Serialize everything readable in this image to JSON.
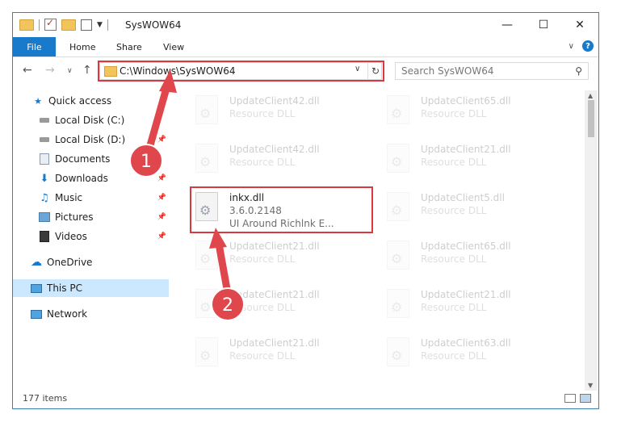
{
  "window": {
    "title": "SysWOW64",
    "minimize_glyph": "—",
    "maximize_glyph": "☐",
    "close_glyph": "✕"
  },
  "ribbon": {
    "tabs": [
      "File",
      "Home",
      "Share",
      "View"
    ]
  },
  "address": {
    "path": "C:\\Windows\\SysWOW64",
    "search_placeholder": "Search SysWOW64"
  },
  "navpane": {
    "items": [
      {
        "label": "Quick access",
        "icon": "star-icon"
      },
      {
        "label": "Local Disk (C:)",
        "icon": "drive-icon"
      },
      {
        "label": "Local Disk (D:)",
        "icon": "drive-icon"
      },
      {
        "label": "Documents",
        "icon": "documents-icon"
      },
      {
        "label": "Downloads",
        "icon": "downloads-icon"
      },
      {
        "label": "Music",
        "icon": "music-icon"
      },
      {
        "label": "Pictures",
        "icon": "pictures-icon"
      },
      {
        "label": "Videos",
        "icon": "videos-icon"
      },
      {
        "label": "OneDrive",
        "icon": "cloud-icon"
      },
      {
        "label": "This PC",
        "icon": "computer-icon"
      },
      {
        "label": "Network",
        "icon": "network-icon"
      }
    ]
  },
  "files": {
    "col1": [
      {
        "name": "UpdateClient42.dll",
        "type": "Resource DLL"
      },
      {
        "name": "UpdateClient42.dll",
        "type": "Resource DLL"
      },
      {
        "name": "UpdateClient21.dll",
        "type": "Resource DLL"
      },
      {
        "name": "UpdateClient21.dll",
        "type": "Resource DLL"
      },
      {
        "name": "UpdateClient21.dll",
        "type": "Resource DLL"
      }
    ],
    "col2": [
      {
        "name": "UpdateClient65.dll",
        "type": "Resource DLL"
      },
      {
        "name": "UpdateClient21.dll",
        "type": "Resource DLL"
      },
      {
        "name": "UpdateClient5.dll",
        "type": "Resource DLL"
      },
      {
        "name": "UpdateClient65.dll",
        "type": "Resource DLL"
      },
      {
        "name": "UpdateClient21.dll",
        "type": "Resource DLL"
      },
      {
        "name": "UpdateClient63.dll",
        "type": "Resource DLL"
      }
    ],
    "selected": {
      "name": "inkx.dll",
      "version": "3.6.0.2148",
      "description": "UI Around Richlnk E..."
    }
  },
  "status": {
    "item_count": "177 items"
  },
  "annotations": {
    "step1": "1",
    "step2": "2",
    "color": "#e0474c"
  }
}
